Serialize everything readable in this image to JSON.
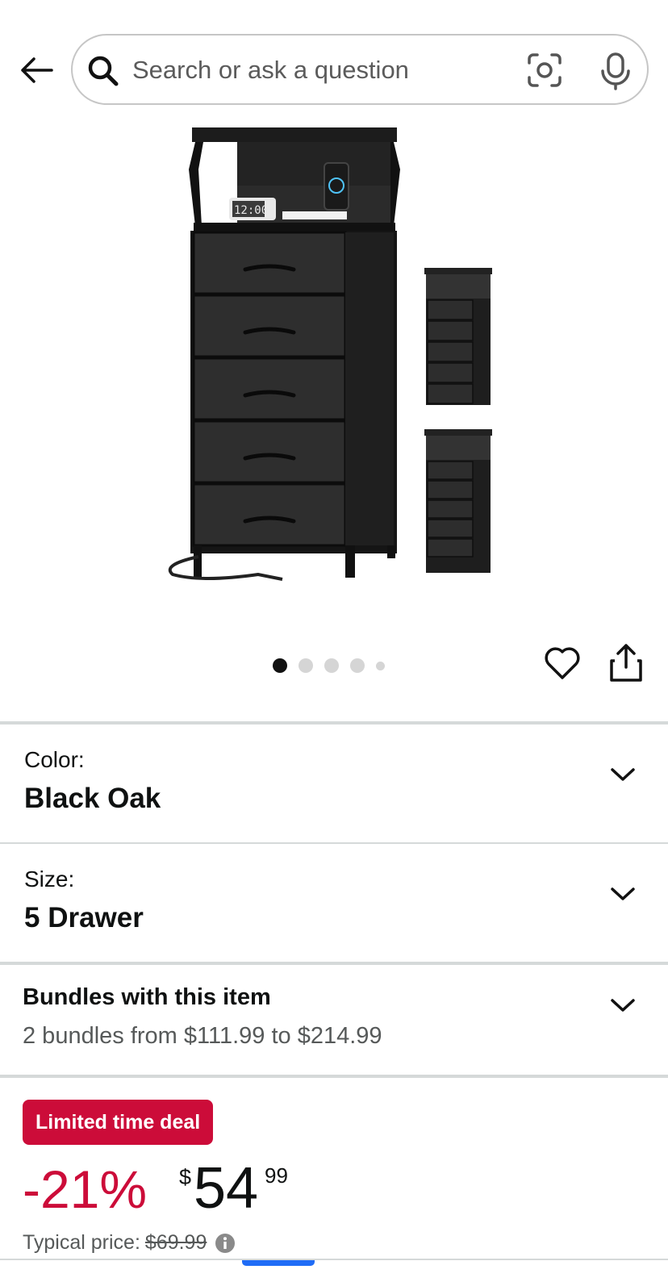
{
  "header": {
    "search_placeholder": "Search or ask a question"
  },
  "image_carousel": {
    "dot_count": 5,
    "active_index": 0
  },
  "variants": {
    "color": {
      "label": "Color:",
      "value": "Black Oak"
    },
    "size": {
      "label": "Size:",
      "value": "5 Drawer"
    }
  },
  "bundles": {
    "title": "Bundles with this item",
    "subtitle": "2 bundles from $111.99 to $214.99"
  },
  "deal": {
    "badge": "Limited time deal",
    "discount": "-21%",
    "currency": "$",
    "price_whole": "54",
    "price_fraction": "99",
    "typical_label": "Typical price:",
    "typical_price": "$69.99"
  },
  "colors": {
    "deal_red": "#cc0c39",
    "text": "#0f1111",
    "secondary_text": "#565959",
    "divider": "#d5d9d9",
    "accent_blue": "#1f6cf6"
  }
}
